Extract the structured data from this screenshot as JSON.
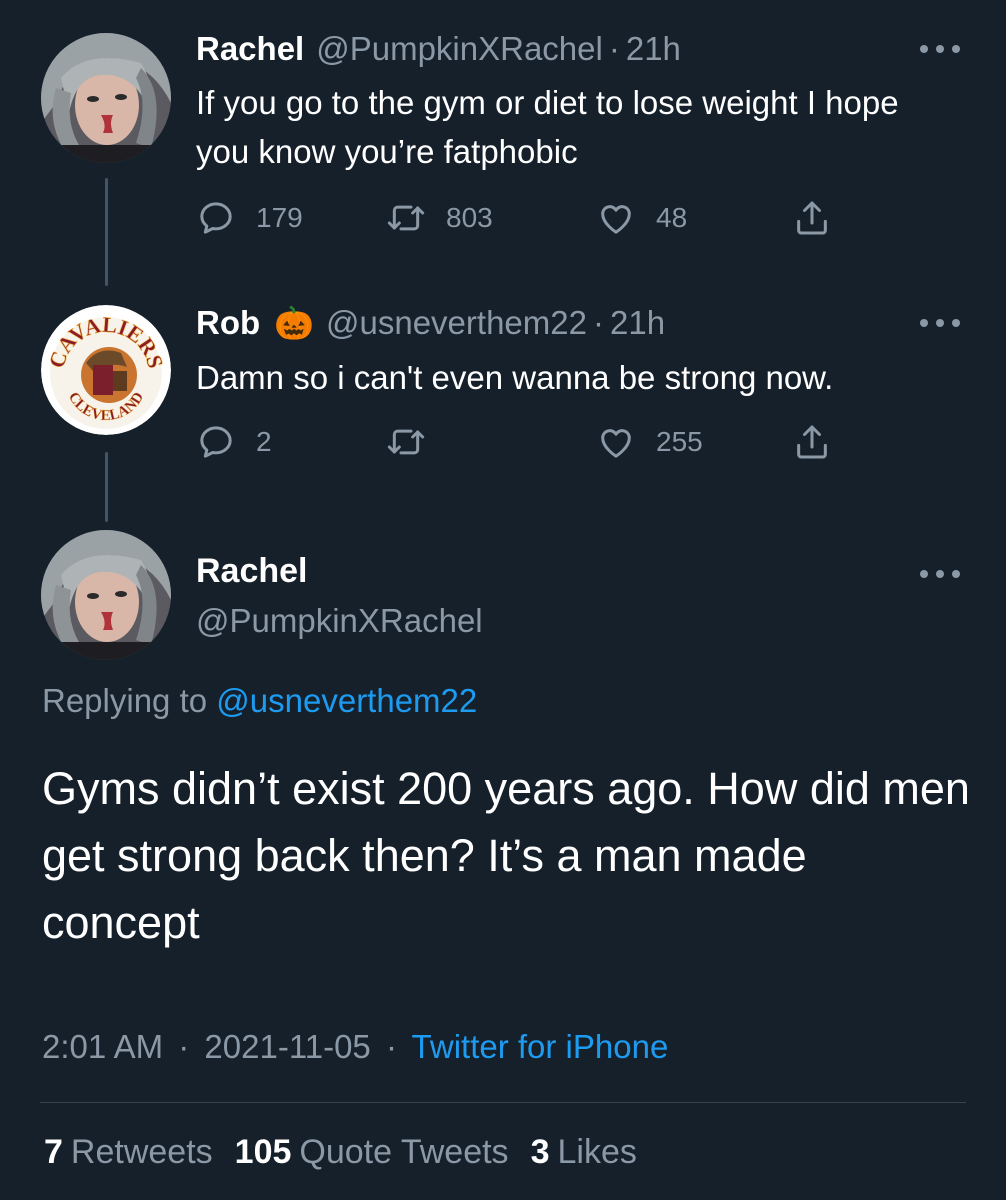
{
  "tweet1": {
    "name": "Rachel",
    "handle": "@PumpkinXRachel",
    "time": "21h",
    "text": "If you go to the gym or diet to lose weight I hope you know you’re fatphobic",
    "replies": "179",
    "retweets": "803",
    "likes": "48"
  },
  "tweet2": {
    "name": "Rob",
    "emoji": "🎃",
    "handle": "@usneverthem22",
    "time": "21h",
    "text": "Damn so i can't even wanna be strong now.",
    "replies": "2",
    "retweets": "",
    "likes": "255",
    "avatar_text_top": "CAVALIERS",
    "avatar_text_bottom": "CLEVELAND"
  },
  "main": {
    "name": "Rachel",
    "handle": "@PumpkinXRachel",
    "replying_prefix": "Replying to",
    "replying_to": "@usneverthem22",
    "text": "Gyms didn’t exist 200 years ago. How did men get strong back then? It’s a man made concept",
    "time": "2:01 AM",
    "date": "2021-11-05",
    "source": "Twitter for iPhone",
    "sep": "·",
    "retweets_count": "7",
    "retweets_label": "Retweets",
    "quotes_count": "105",
    "quotes_label": "Quote Tweets",
    "likes_count": "3",
    "likes_label": "Likes"
  },
  "colors": {
    "background": "#15202b",
    "secondary_text": "#8b98a5",
    "link": "#1d9bf0"
  }
}
